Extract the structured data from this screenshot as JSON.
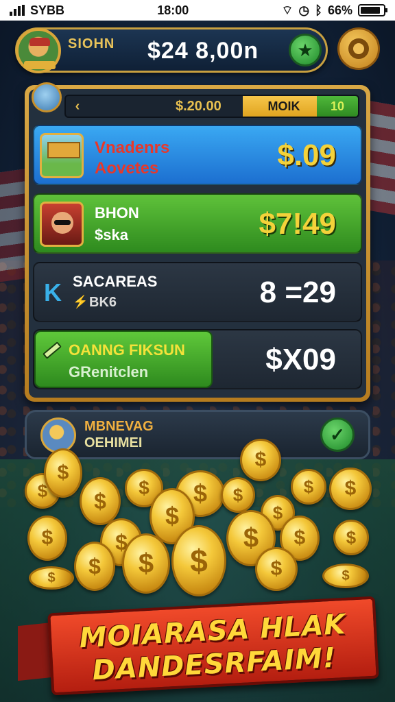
{
  "status_bar": {
    "carrier": "SYBB",
    "time": "18:00",
    "battery": "66%"
  },
  "header": {
    "player_name": "SIOHN",
    "balance": "$24 8,00n"
  },
  "tabs": {
    "back_icon": "chevron-left",
    "amount": "$.20.00",
    "mode": "MOIK",
    "count": "10"
  },
  "offers": [
    {
      "title": "Vnadenrs",
      "subtitle": "Aovetes",
      "price": "$.09"
    },
    {
      "title": "BHON",
      "subtitle": "$ska",
      "price": "$7!49"
    },
    {
      "title": "SACAREAS",
      "subtitle": "BK6",
      "price": "8 =29"
    },
    {
      "title": "OANNG FIKSUN",
      "subtitle": "GRenitclen",
      "price": "$X09"
    }
  ],
  "banner": {
    "line1": "MBNEVAG",
    "line2": "OEHIMEI"
  },
  "ribbon": {
    "line1": "MOIARASA HLAK",
    "line2": "DANDESRFAIM!"
  },
  "colors": {
    "gold": "#e8c050",
    "green": "#4fb83a",
    "blue": "#1c6fd0",
    "red": "#d2301c"
  }
}
